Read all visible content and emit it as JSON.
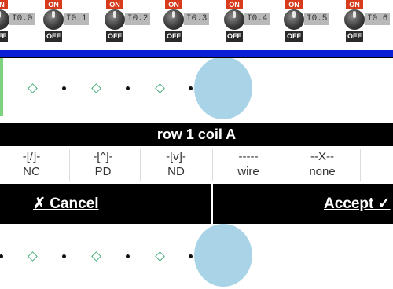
{
  "switches": [
    {
      "on_label": "ON",
      "off_label": "OFF",
      "address": "I0.0"
    },
    {
      "on_label": "ON",
      "off_label": "OFF",
      "address": "I0.1"
    },
    {
      "on_label": "ON",
      "off_label": "OFF",
      "address": "I0.2"
    },
    {
      "on_label": "ON",
      "off_label": "OFF",
      "address": "I0.3"
    },
    {
      "on_label": "ON",
      "off_label": "OFF",
      "address": "I0.4"
    },
    {
      "on_label": "ON",
      "off_label": "OFF",
      "address": "I0.5"
    },
    {
      "on_label": "ON",
      "off_label": "OFF",
      "address": "I0.6"
    }
  ],
  "dialog": {
    "title": "row 1 coil A",
    "options": [
      {
        "code": "-[/]-",
        "name": "NC"
      },
      {
        "code": "-[^]-",
        "name": "PD"
      },
      {
        "code": "-[v]-",
        "name": "ND"
      },
      {
        "code": "-----",
        "name": "wire"
      },
      {
        "code": "--X--",
        "name": "none"
      }
    ],
    "cancel_label": "✗ Cancel",
    "accept_label": "Accept ✓"
  },
  "colors": {
    "switch_on": "#d83a1c",
    "header_bar": "#0a1fd6",
    "selection_bubble": "#a9d4e8",
    "diamond_marker": "#4caf7d",
    "rail": "#7ed17e"
  }
}
